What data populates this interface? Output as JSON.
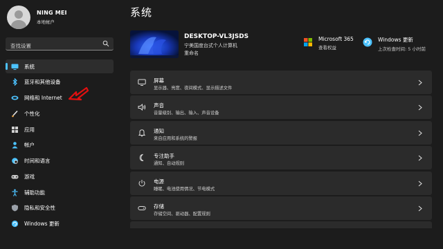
{
  "profile": {
    "name": "NING MEI",
    "subtitle": "本地帐户"
  },
  "search": {
    "placeholder": "查找设置"
  },
  "nav": [
    {
      "label": "系统",
      "icon": "monitor-icon",
      "active": true
    },
    {
      "label": "蓝牙和其他设备",
      "icon": "bluetooth-icon"
    },
    {
      "label": "网络和 Internet",
      "icon": "wifi-icon"
    },
    {
      "label": "个性化",
      "icon": "brush-icon"
    },
    {
      "label": "应用",
      "icon": "apps-icon"
    },
    {
      "label": "帐户",
      "icon": "person-icon"
    },
    {
      "label": "时间和语言",
      "icon": "globe-clock-icon"
    },
    {
      "label": "游戏",
      "icon": "gamepad-icon"
    },
    {
      "label": "辅助功能",
      "icon": "accessibility-icon"
    },
    {
      "label": "隐私和安全性",
      "icon": "shield-icon"
    },
    {
      "label": "Windows 更新",
      "icon": "windows-update-icon"
    }
  ],
  "page_title": "系统",
  "device": {
    "name": "DESKTOP-VL3JSDS",
    "model": "宁美国度台式个人计算机",
    "rename": "重命名"
  },
  "quick": {
    "m365": {
      "title": "Microsoft 365",
      "subtitle": "查看权益"
    },
    "update": {
      "title": "Windows 更新",
      "subtitle": "上次检查时间: 5 小时前"
    }
  },
  "cards": [
    {
      "title": "屏幕",
      "subtitle": "显示器、亮度、夜间模式、显示描述文件",
      "icon": "display-icon"
    },
    {
      "title": "声音",
      "subtitle": "音量级别、输出、输入、声音设备",
      "icon": "speaker-icon"
    },
    {
      "title": "通知",
      "subtitle": "来自应用和系统的警报",
      "icon": "bell-icon"
    },
    {
      "title": "专注助手",
      "subtitle": "通知、自动规则",
      "icon": "moon-icon"
    },
    {
      "title": "电源",
      "subtitle": "睡眠、电池使用情况、节电模式",
      "icon": "power-icon"
    },
    {
      "title": "存储",
      "subtitle": "存储空间、驱动器、配置规则",
      "icon": "storage-icon"
    }
  ],
  "colors": {
    "accent": "#4cc2ff",
    "annotation": "#e01010",
    "card": "#2b2b2b",
    "background": "#1c1c1c"
  }
}
